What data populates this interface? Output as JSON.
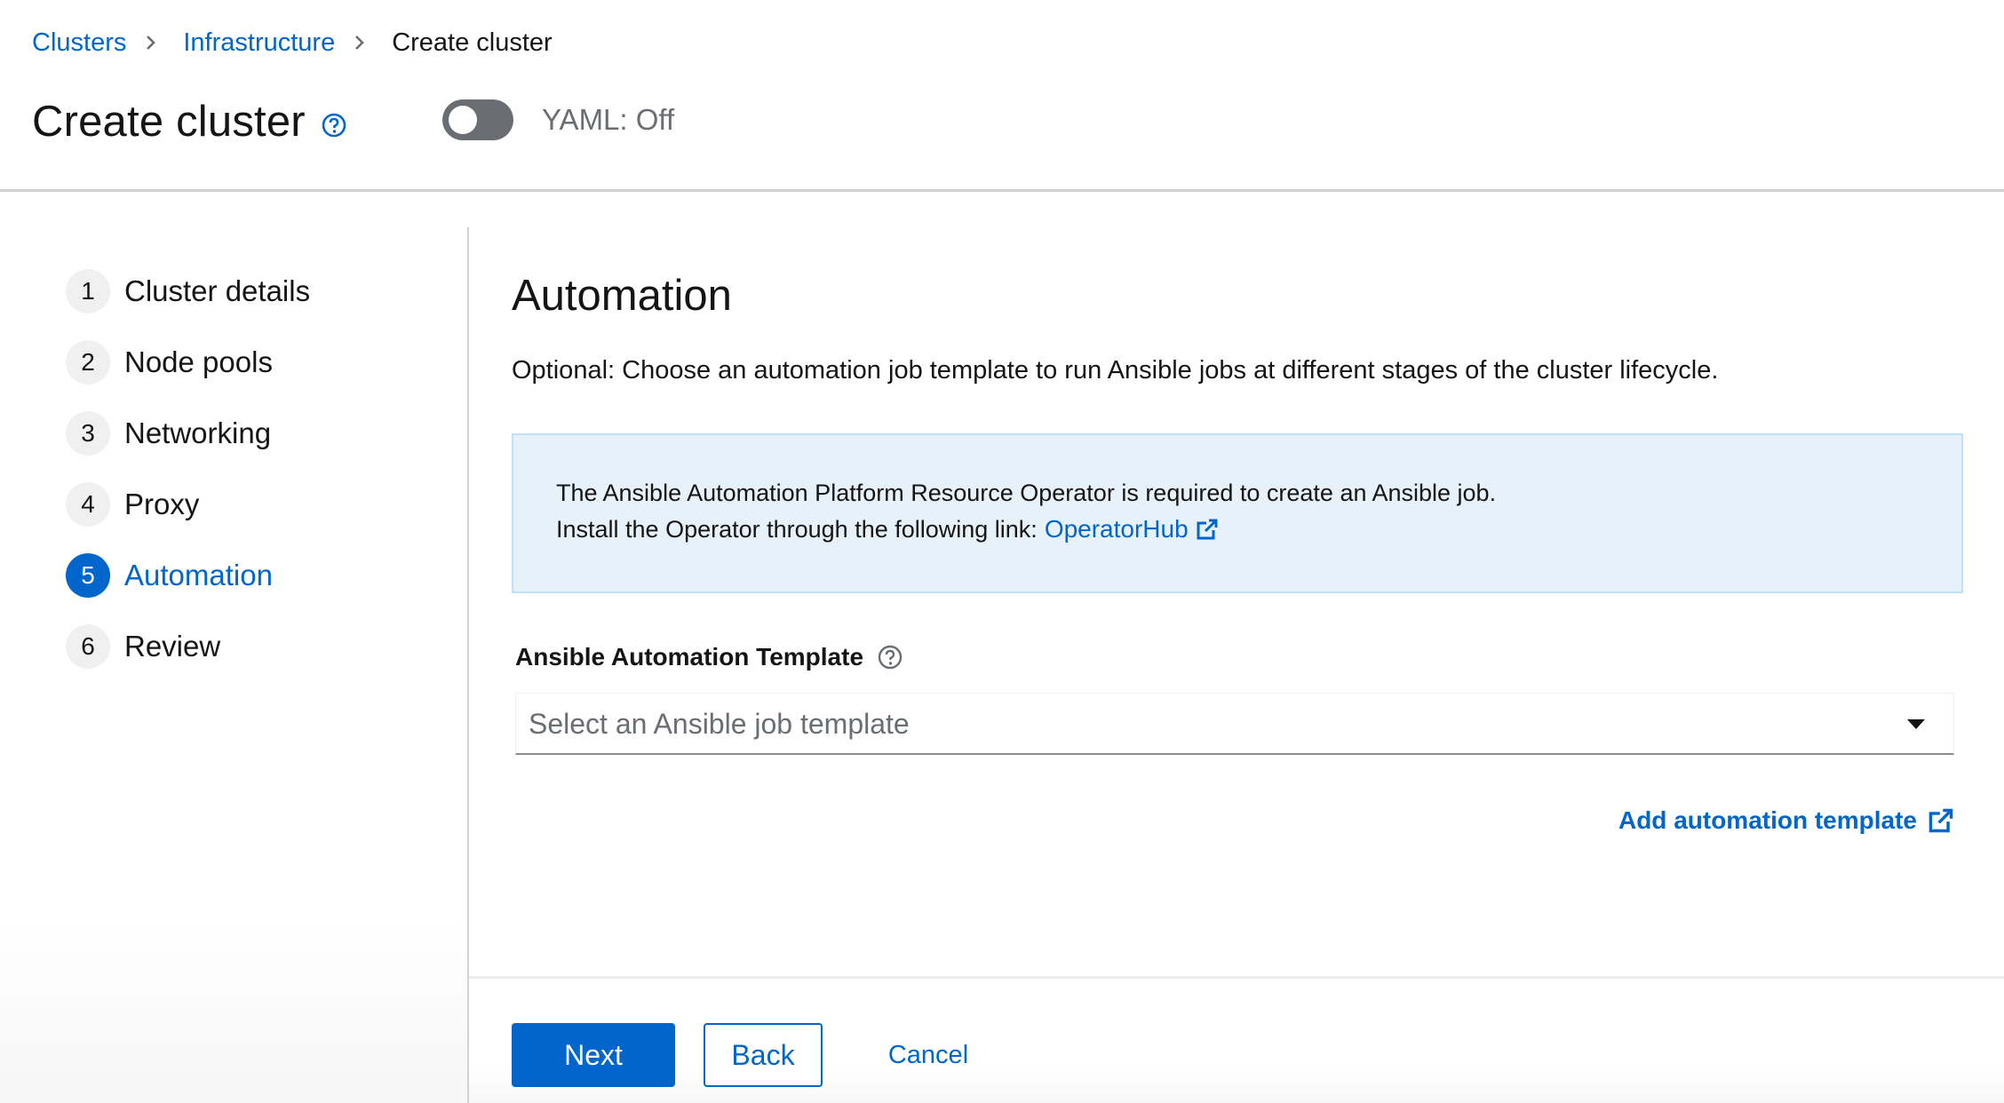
{
  "breadcrumb": {
    "items": [
      "Clusters",
      "Infrastructure"
    ],
    "current": "Create cluster"
  },
  "header": {
    "title": "Create cluster",
    "help_icon": "help-circle-icon",
    "yaml_toggle": {
      "label": "YAML: Off",
      "on": false
    }
  },
  "wizard": {
    "steps": [
      {
        "number": "1",
        "label": "Cluster details"
      },
      {
        "number": "2",
        "label": "Node pools"
      },
      {
        "number": "3",
        "label": "Networking"
      },
      {
        "number": "4",
        "label": "Proxy"
      },
      {
        "number": "5",
        "label": "Automation"
      },
      {
        "number": "6",
        "label": "Review"
      }
    ],
    "current_step": 5
  },
  "automation": {
    "title": "Automation",
    "description": "Optional: Choose an automation job template to run Ansible jobs at different stages of the cluster lifecycle.",
    "alert": {
      "line1": "The Ansible Automation Platform Resource Operator is required to create an Ansible job.",
      "line2": "Install the Operator through the following link:",
      "link": "OperatorHub",
      "link_icon": "external-link-icon"
    },
    "field_label": "Ansible Automation Template",
    "select_placeholder": "Select an Ansible job template",
    "add_template_link": "Add automation template"
  },
  "footer": {
    "next": "Next",
    "back": "Back",
    "cancel": "Cancel"
  },
  "colors": {
    "accent": "#0066cc",
    "alert_bg": "#e7f1fa",
    "toggle_off": "#6a6e73"
  }
}
